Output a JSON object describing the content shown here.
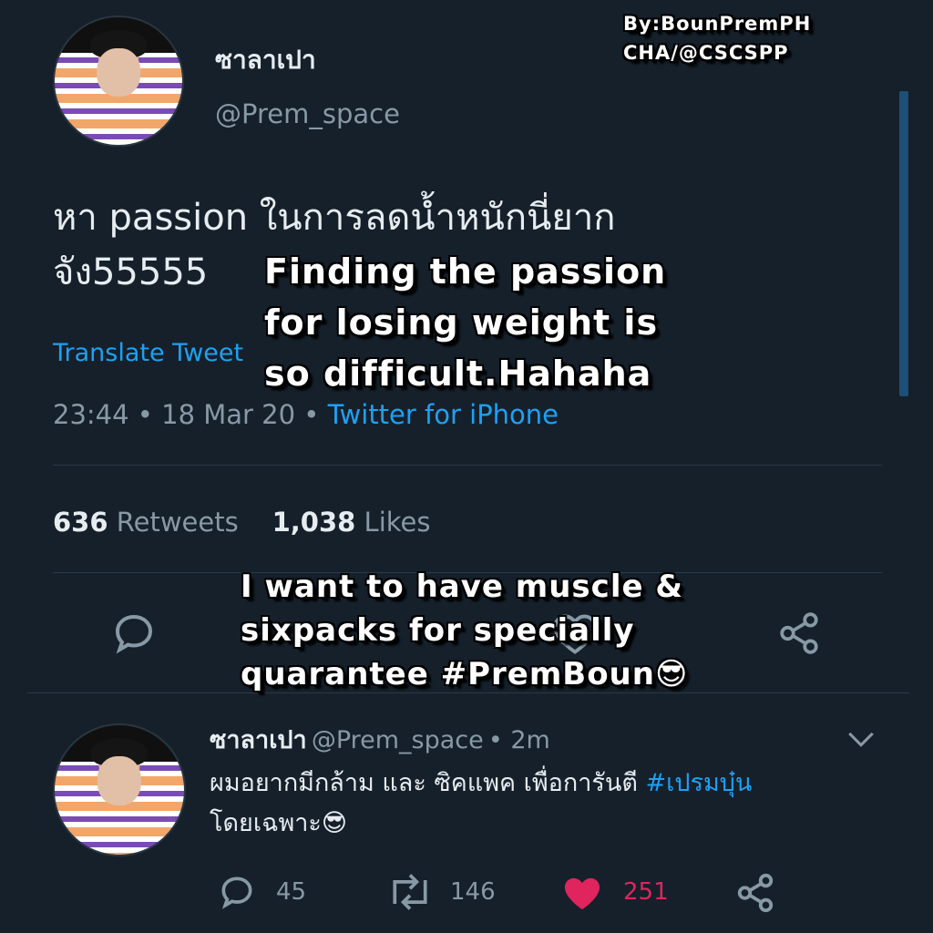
{
  "overlay": {
    "credit_line1": "By:BounPremPH",
    "credit_line2": "CHA/@CSCSPP",
    "caption1_lines": [
      "Finding the passion",
      "for losing weight is",
      "so difficult.Hahaha"
    ],
    "caption2_lines": [
      "I want to have muscle &",
      "sixpacks  for specially",
      "quarantee #PremBoun😎"
    ]
  },
  "tweet": {
    "display_name": "ซาลาเปา",
    "handle": "@Prem_space",
    "text_line1": "หา passion ในการลดน้ำหนักนี่ยาก",
    "text_line2": "จัง55555",
    "translate_label": "Translate Tweet",
    "timestamp": "23:44 • 18 Mar 20 •",
    "source": "Twitter for iPhone",
    "retweets_count": "636",
    "retweets_label": "Retweets",
    "likes_count": "1,038",
    "likes_label": "Likes"
  },
  "reply": {
    "display_name": "ซาลาเปา",
    "handle": "@Prem_space",
    "time": "• 2m",
    "text_line1_a": "ผมอยากมีกล้าม และ ซิคแพค เพื่อการันตี ",
    "text_hashtag": "#เปรมบุ๋น",
    "text_line2": "โดยเฉพาะ😎",
    "reply_count": "45",
    "retweet_count": "146",
    "like_count": "251"
  },
  "icons": {
    "reply": "reply-icon",
    "retweet": "retweet-icon",
    "like": "heart-icon",
    "share": "share-icon",
    "chevron": "chevron-down-icon"
  },
  "colors": {
    "background": "#15202b",
    "link": "#1da1f2",
    "muted": "#8899a6",
    "like": "#e0245e"
  }
}
